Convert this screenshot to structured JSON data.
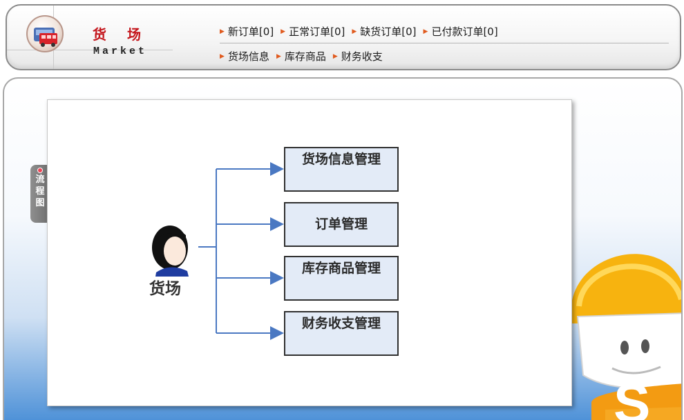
{
  "brand": {
    "title_cn": "货场",
    "title_en": "Market"
  },
  "nav": {
    "row1": [
      {
        "label": "新订单[0]"
      },
      {
        "label": "正常订单[0]"
      },
      {
        "label": "缺货订单[0]"
      },
      {
        "label": "已付款订单[0]"
      }
    ],
    "row2": [
      {
        "label": "货场信息"
      },
      {
        "label": "库存商品"
      },
      {
        "label": "财务收支"
      }
    ]
  },
  "side_tab": {
    "label": "流程图"
  },
  "flowchart": {
    "actor": "货场",
    "boxes": [
      {
        "label": "货场信息管理"
      },
      {
        "label": "订单管理"
      },
      {
        "label": "库存商品管理"
      },
      {
        "label": "财务收支管理"
      }
    ]
  },
  "mascot": {
    "letter": "S"
  },
  "colors": {
    "brand_red": "#c4161c",
    "arrow_orange": "#e05a1e",
    "box_fill": "#e3ebf7",
    "connector": "#4a78c2"
  }
}
